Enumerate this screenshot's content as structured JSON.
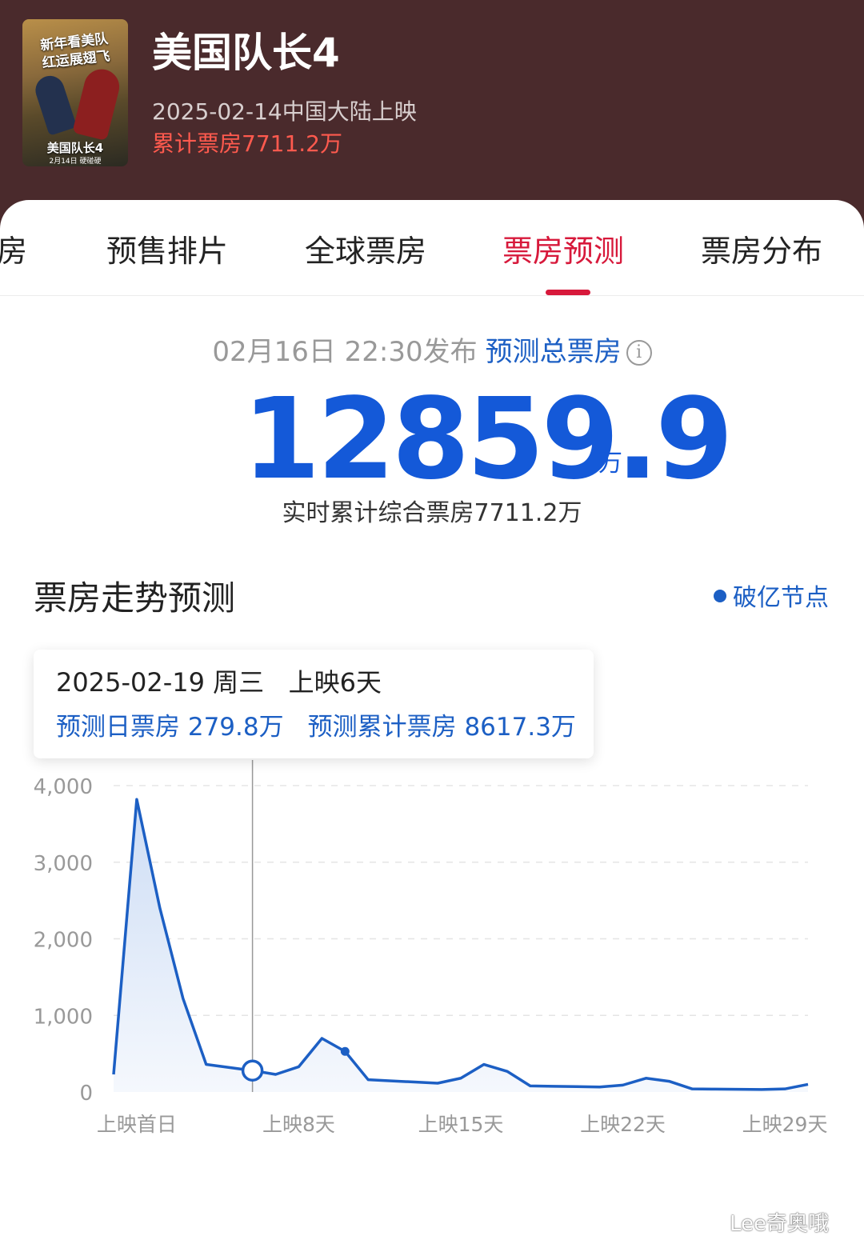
{
  "movie": {
    "poster": {
      "slogan_line1": "新年看美队",
      "slogan_line2": "红运展翅飞",
      "title": "美国队长4",
      "date": "2月14日 硬碰硬"
    },
    "title": "美国队长4",
    "release": "2025-02-14中国大陆上映",
    "cumulative": "累计票房7711.2万"
  },
  "tabs": [
    {
      "label": "票房"
    },
    {
      "label": "预售排片"
    },
    {
      "label": "全球票房"
    },
    {
      "label": "票房预测"
    },
    {
      "label": "票房分布"
    }
  ],
  "active_tab": "票房预测",
  "forecast": {
    "published": "02月16日 22:30发布",
    "label": "预测总票房",
    "info_icon": "info-circle-icon",
    "total": "12859.9",
    "unit": "万",
    "realtime": "实时累计综合票房7711.2万"
  },
  "trend": {
    "title": "票房走势预测",
    "legend": "破亿节点",
    "tooltip": {
      "date": "2025-02-19 周三",
      "day": "上映6天",
      "daily": "预测日票房 279.8万",
      "cumulative": "预测累计票房 8617.3万"
    }
  },
  "chart_data": {
    "type": "area",
    "x_ticks": [
      "上映首日",
      "上映8天",
      "上映15天",
      "上映22天",
      "上映29天"
    ],
    "y_ticks": [
      "0",
      "1,000",
      "2,000",
      "3,000",
      "4,000"
    ],
    "ylim": [
      0,
      4000
    ],
    "x_range": [
      0,
      30
    ],
    "y_values": [
      230,
      3820,
      2400,
      1220,
      360,
      320,
      279.8,
      230,
      330,
      700,
      530,
      160,
      145,
      130,
      115,
      180,
      360,
      270,
      80,
      75,
      70,
      65,
      90,
      180,
      140,
      40,
      38,
      35,
      32,
      40,
      100
    ],
    "highlight_day_index": 6,
    "milestone_day_index": 10,
    "colors": {
      "line": "#1c5fc4",
      "area_top": "#cdddf5",
      "area_bottom": "#f5f8fd",
      "grid": "#e5e5e5",
      "ticks": "#999999"
    }
  },
  "watermark": "Lee奇奥哦"
}
